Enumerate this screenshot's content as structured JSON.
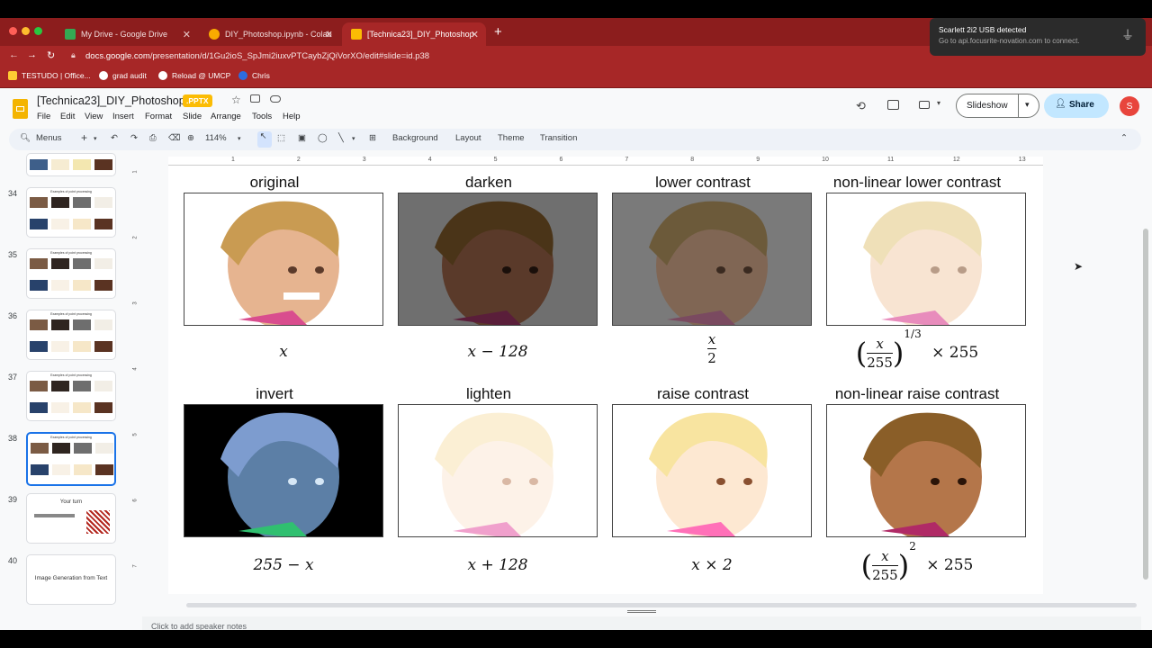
{
  "browser": {
    "tabs": [
      {
        "label": "My Drive - Google Drive",
        "active": false,
        "color": "#34a853"
      },
      {
        "label": "DIY_Photoshop.ipynb - Colab",
        "active": false,
        "color": "#f9ab00"
      },
      {
        "label": "[Technica23]_DIY_Photoshop",
        "active": true,
        "color": "#fbbc04"
      }
    ],
    "new_tab": "+",
    "url_domain": "docs.google.com",
    "url_path": "/presentation/d/1Gu2ioS_SpJmi2iuxvPTCaybZjQiVorXO/edit#slide=id.p38",
    "bookmarks": [
      "TESTUDO | Office...",
      "grad audit",
      "Reload @ UMCP",
      "Chris"
    ]
  },
  "notification": {
    "title": "Scarlett 2i2 USB detected",
    "body": "Go to api.focusrite-novation.com to connect."
  },
  "app": {
    "title": "[Technica23]_DIY_Photoshop",
    "badge": ".PPTX",
    "menus": [
      "File",
      "Edit",
      "View",
      "Insert",
      "Format",
      "Slide",
      "Arrange",
      "Tools",
      "Help"
    ],
    "slideshow": "Slideshow",
    "share": "Share",
    "avatar": "S",
    "toolbar": {
      "menus": "Menus",
      "zoom": "114%",
      "background": "Background",
      "layout": "Layout",
      "theme": "Theme",
      "transition": "Transition"
    },
    "speaker_notes": "Click to add speaker notes"
  },
  "filmstrip": {
    "slides": [
      {
        "num": "34",
        "title": "Examples of point processing"
      },
      {
        "num": "35",
        "title": "Examples of point processing"
      },
      {
        "num": "36",
        "title": "Examples of point processing"
      },
      {
        "num": "37",
        "title": "Examples of point processing"
      },
      {
        "num": "38",
        "title": "Examples of point processing",
        "selected": true
      },
      {
        "num": "39",
        "title": "Your turn"
      },
      {
        "num": "40",
        "title": "Image Generation from Text"
      }
    ]
  },
  "ruler": [
    "1",
    "2",
    "3",
    "4",
    "5",
    "6",
    "7",
    "8",
    "9",
    "10",
    "11",
    "12",
    "13"
  ],
  "vruler": [
    "1",
    "2",
    "3",
    "4",
    "5",
    "6",
    "7"
  ],
  "slide": {
    "row1": [
      {
        "caption": "original",
        "formula": "x"
      },
      {
        "caption": "darken",
        "formula": "x − 128"
      },
      {
        "caption": "lower contrast",
        "formula_num": "x",
        "formula_den": "2"
      },
      {
        "caption": "non-linear lower contrast",
        "formula_num": "x",
        "formula_den": "255",
        "formula_exp": "1/3",
        "formula_tail": "× 255"
      }
    ],
    "row2": [
      {
        "caption": "invert",
        "formula": "255 − x"
      },
      {
        "caption": "lighten",
        "formula": "x + 128"
      },
      {
        "caption": "raise contrast",
        "formula": "x × 2"
      },
      {
        "caption": "non-linear raise contrast",
        "formula_num": "x",
        "formula_den": "255",
        "formula_exp": "2",
        "formula_tail": "× 255"
      }
    ]
  }
}
